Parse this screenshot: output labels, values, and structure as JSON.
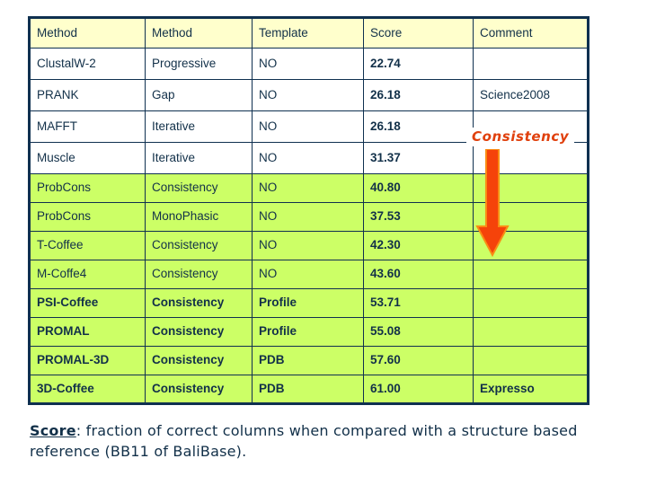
{
  "table": {
    "columns": [
      "Method",
      "Method",
      "Template",
      "Score",
      "Comment"
    ],
    "rows": [
      {
        "method1": "ClustalW-2",
        "method2": "Progressive",
        "template": "NO",
        "score": "22.74",
        "comment": "",
        "shade": "white",
        "bold": false
      },
      {
        "method1": "PRANK",
        "method2": "Gap",
        "template": "NO",
        "score": "26.18",
        "comment": "Science2008",
        "shade": "white",
        "bold": false
      },
      {
        "method1": "MAFFT",
        "method2": "Iterative",
        "template": "NO",
        "score": "26.18",
        "comment": "",
        "shade": "white",
        "bold": false
      },
      {
        "method1": "Muscle",
        "method2": "Iterative",
        "template": "NO",
        "score": "31.37",
        "comment": "",
        "shade": "white",
        "bold": false
      },
      {
        "method1": "ProbCons",
        "method2": "Consistency",
        "template": "NO",
        "score": "40.80",
        "comment": "",
        "shade": "green",
        "bold": false
      },
      {
        "method1": "ProbCons",
        "method2": "MonoPhasic",
        "template": "NO",
        "score": "37.53",
        "comment": "",
        "shade": "green",
        "bold": false
      },
      {
        "method1": "T-Coffee",
        "method2": "Consistency",
        "template": "NO",
        "score": "42.30",
        "comment": "",
        "shade": "green",
        "bold": false
      },
      {
        "method1": "M-Coffe4",
        "method2": "Consistency",
        "template": "NO",
        "score": "43.60",
        "comment": "",
        "shade": "green",
        "bold": false
      },
      {
        "method1": "PSI-Coffee",
        "method2": "Consistency",
        "template": "Profile",
        "score": "53.71",
        "comment": "",
        "shade": "green",
        "bold": true
      },
      {
        "method1": "PROMAL",
        "method2": "Consistency",
        "template": "Profile",
        "score": "55.08",
        "comment": "",
        "shade": "green",
        "bold": true
      },
      {
        "method1": "PROMAL-3D",
        "method2": "Consistency",
        "template": "PDB",
        "score": "57.60",
        "comment": "",
        "shade": "green",
        "bold": true
      },
      {
        "method1": "3D-Coffee",
        "method2": "Consistency",
        "template": "PDB",
        "score": "61.00",
        "comment": "Expresso",
        "shade": "green",
        "bold": true
      }
    ]
  },
  "annotation": {
    "label": "Consistency",
    "arrow_icon": "down-arrow-icon"
  },
  "caption": {
    "term": "Score",
    "separator": ":",
    "text": " fraction of correct columns when compared with a structure based reference (BB11 of BaliBase)."
  },
  "colors": {
    "header_fill": "#ffffcc",
    "row_white": "#ffffff",
    "row_green": "#ccff66",
    "border": "#0f3050",
    "text": "#123049",
    "accent_red": "#e0400d",
    "arrow_fill": "#f5430a"
  }
}
